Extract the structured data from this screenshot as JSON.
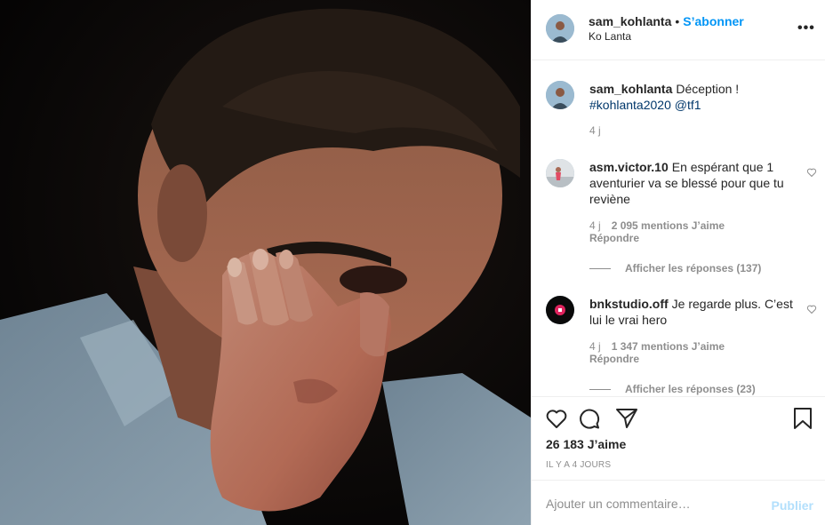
{
  "header": {
    "username": "sam_kohlanta",
    "separator": "•",
    "follow_label": "S’abonner",
    "location": "Ko Lanta",
    "more_label": "•••"
  },
  "caption": {
    "username": "sam_kohlanta",
    "text": "Déception !",
    "hashtag": "#kohlanta2020",
    "mention": "@tf1",
    "time": "4 j"
  },
  "comments": [
    {
      "username": "asm.victor.10",
      "text": "En espérant que 1 aventurier va se blessé pour que tu reviène",
      "time": "4 j",
      "likes": "2 095 mentions J’aime",
      "reply_label": "Répondre",
      "view_replies": "Afficher les réponses (137)"
    },
    {
      "username": "bnkstudio.off",
      "text": "Je regarde plus. C’est lui le vrai hero",
      "time": "4 j",
      "likes": "1 347 mentions J’aime",
      "reply_label": "Répondre",
      "view_replies": "Afficher les réponses (23)"
    }
  ],
  "actions": {
    "icons": [
      "heart-icon",
      "comment-icon",
      "share-icon",
      "bookmark-icon"
    ],
    "likes_total": "26 183 J’aime",
    "time_ago": "IL Y A 4 JOURS"
  },
  "add_comment": {
    "placeholder": "Ajouter un commentaire…",
    "value": "",
    "publish_label": "Publier"
  },
  "colors": {
    "accent": "#0095f6",
    "link": "#00376b",
    "publish_disabled": "#b2dffc",
    "muted": "#8e8e8e"
  }
}
